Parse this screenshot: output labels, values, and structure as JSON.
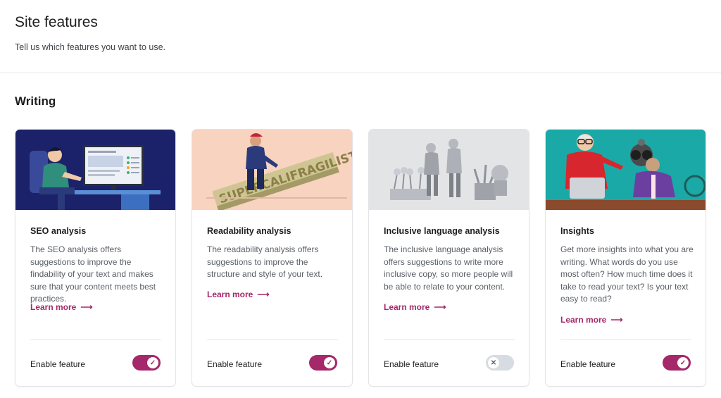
{
  "header": {
    "title": "Site features",
    "subtitle": "Tell us which features you want to use."
  },
  "section": {
    "title": "Writing"
  },
  "cards": [
    {
      "title": "SEO analysis",
      "description": "The SEO analysis offers suggestions to improve the findability of your text and makes sure that your content meets best practices.",
      "learn_more": "Learn more",
      "enable_label": "Enable feature",
      "enabled": true,
      "image_bg": "#1c2269"
    },
    {
      "title": "Readability analysis",
      "description": "The readability analysis offers suggestions to improve the structure and style of your text.",
      "learn_more": "Learn more",
      "enable_label": "Enable feature",
      "enabled": true,
      "image_bg": "#f7d3c0"
    },
    {
      "title": "Inclusive language analysis",
      "description": "The inclusive language analysis offers suggestions to write more inclusive copy, so more people will be able to relate to your content.",
      "learn_more": "Learn more",
      "enable_label": "Enable feature",
      "enabled": false,
      "image_bg": "#e3e4e6"
    },
    {
      "title": "Insights",
      "description": "Get more insights into what you are writing. What words do you use most often? How much time does it take to read your text? Is your text easy to read?",
      "learn_more": "Learn more",
      "enable_label": "Enable feature",
      "enabled": true,
      "image_bg": "#1aa9a6"
    }
  ],
  "illustration_text": {
    "readability_banner": "SUPERCALIFRAGILISTIC"
  },
  "colors": {
    "accent": "#a4286a",
    "toggle_off": "#d7dbe2",
    "border": "#e2e4e7"
  },
  "icons": {
    "arrow": "arrow-right-icon",
    "check": "check-icon",
    "close": "close-icon"
  }
}
